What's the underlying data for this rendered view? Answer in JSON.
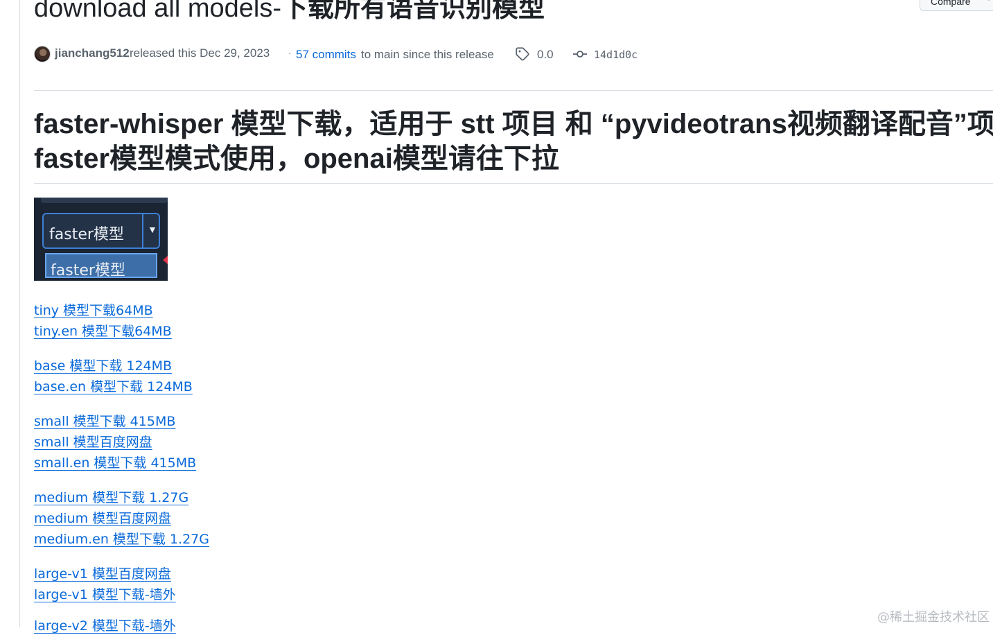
{
  "release": {
    "title_prefix": "download all models-",
    "title_cjk": "下载所有语音识别模型",
    "compare_label": "Compare"
  },
  "meta": {
    "author": "jianchang512",
    "released_text": "released this Dec 29, 2023",
    "dot": "·",
    "commits_link": "57 commits",
    "commits_rest": "to main since this release",
    "tag_icon": "tag-icon",
    "tag": "0.0",
    "commit_icon": "git-commit-icon",
    "sha": "14d1d0c"
  },
  "body": {
    "heading_line1": "faster-whisper 模型下载，适用于 stt 项目 和 “pyvideotrans视频翻译配音”项目",
    "heading_line2": "faster模型模式使用，openai模型请往下拉",
    "preview_image": {
      "combo_text": "faster模型",
      "dropdown_item_text": "faster模型"
    },
    "links": [
      "tiny 模型下载64MB",
      "tiny.en 模型下载64MB",
      "base 模型下载 124MB",
      "base.en 模型下载 124MB",
      "small 模型下载 415MB",
      "small 模型百度网盘",
      "small.en 模型下载 415MB",
      "medium 模型下载 1.27G",
      "medium 模型百度网盘",
      "medium.en 模型下载 1.27G",
      "large-v1 模型百度网盘",
      "large-v1 模型下载-墙外",
      "large-v2 模型下载-墙外"
    ]
  },
  "watermark": "@稀土掘金技术社区"
}
